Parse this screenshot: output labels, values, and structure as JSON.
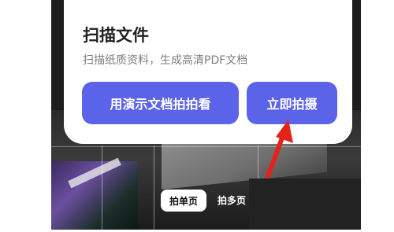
{
  "card": {
    "top_text": "",
    "title": "扫描文件",
    "subtitle": "扫描纸质资料，生成高清PDF文档",
    "demo_button_label": "用演示文档拍拍看",
    "shoot_button_label": "立即拍摄"
  },
  "modes": {
    "single_label": "拍单页",
    "multi_label": "拍多页"
  },
  "colors": {
    "button_bg": "#5b64e8",
    "arrow": "#e3221a"
  }
}
